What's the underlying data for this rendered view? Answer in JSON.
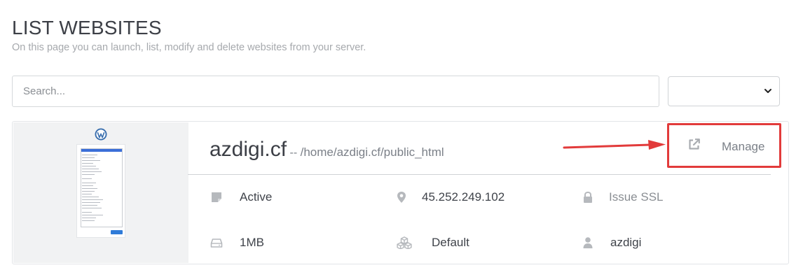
{
  "page": {
    "title": "LIST WEBSITES",
    "subtitle": "On this page you can launch, list, modify and delete websites from your server."
  },
  "search": {
    "placeholder": "Search...",
    "value": ""
  },
  "filter": {
    "selected": "",
    "icon": "chevron-down-icon"
  },
  "website": {
    "domain": "azdigi.cf",
    "separator": "--",
    "path": "/home/azdigi.cf/public_html",
    "manage_label": "Manage",
    "status": "Active",
    "ip": "45.252.249.102",
    "ssl": "Issue SSL",
    "disk": "1MB",
    "package": "Default",
    "owner": "azdigi"
  },
  "icons": {
    "status": "status-icon",
    "ip": "map-pin-icon",
    "ssl": "lock-icon",
    "disk": "hard-drive-icon",
    "package": "cubes-icon",
    "owner": "user-icon",
    "manage": "external-link-icon"
  },
  "colors": {
    "annotation_red": "#e23b3b",
    "muted_text": "#7b8088",
    "icon_gray": "#b6b9bd"
  }
}
